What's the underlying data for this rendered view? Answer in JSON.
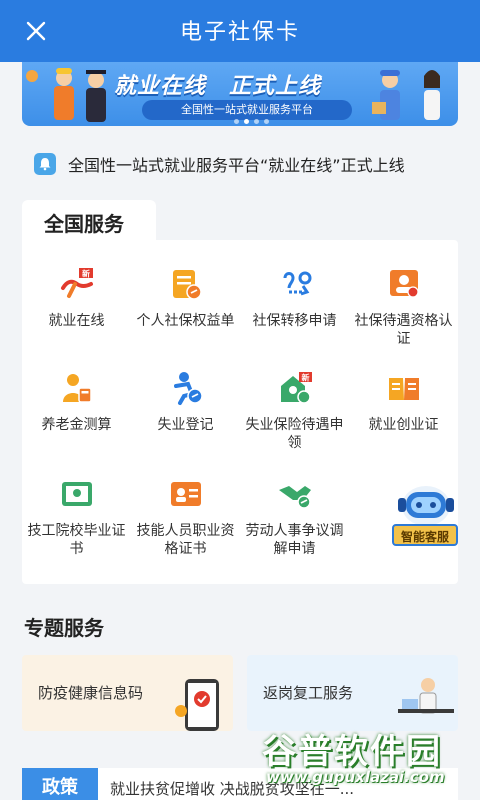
{
  "header": {
    "title": "电子社保卡",
    "close_icon": "close-icon"
  },
  "banner": {
    "headline": "就业在线　正式上线",
    "subtitle": "全国性一站式就业服务平台",
    "active_dot": 1,
    "dot_count": 4
  },
  "notice": {
    "icon": "bell-icon",
    "text": "全国性一站式就业服务平台“就业在线”正式上线"
  },
  "national": {
    "title": "全国服务",
    "items": [
      {
        "label": "就业在线",
        "icon": "jiuye-online-icon"
      },
      {
        "label": "个人社保权益单",
        "icon": "rights-document-icon"
      },
      {
        "label": "社保转移申请",
        "icon": "transfer-route-icon"
      },
      {
        "label": "社保待遇资格认证",
        "icon": "qualification-cert-icon"
      },
      {
        "label": "养老金测算",
        "icon": "pension-calculator-icon"
      },
      {
        "label": "失业登记",
        "icon": "unemployment-register-icon"
      },
      {
        "label": "失业保险待遇申领",
        "icon": "unemployment-insurance-icon"
      },
      {
        "label": "就业创业证",
        "icon": "employment-book-icon"
      },
      {
        "label": "技工院校毕业证书",
        "icon": "graduation-certificate-icon"
      },
      {
        "label": "技能人员职业资格证书",
        "icon": "skill-certificate-icon"
      },
      {
        "label": "劳动人事争议调解申请",
        "icon": "handshake-mediation-icon"
      },
      {
        "label": "",
        "icon": ""
      }
    ]
  },
  "chatbot": {
    "label": "智能客服"
  },
  "topics": {
    "title": "专题服务",
    "items": [
      {
        "label": "防疫健康信息码"
      },
      {
        "label": "返岗复工服务"
      }
    ]
  },
  "policy": {
    "tag": "政策",
    "text": "就业扶贫促增收 决战脱贫攻坚在一..."
  },
  "watermark": {
    "text": "谷普软件园",
    "url": "www.gupuxlazai.com"
  },
  "colors": {
    "primary": "#2a7ce0",
    "orange": "#f07c2a",
    "green": "#3aa86a",
    "badge_red": "#e23b2e"
  }
}
